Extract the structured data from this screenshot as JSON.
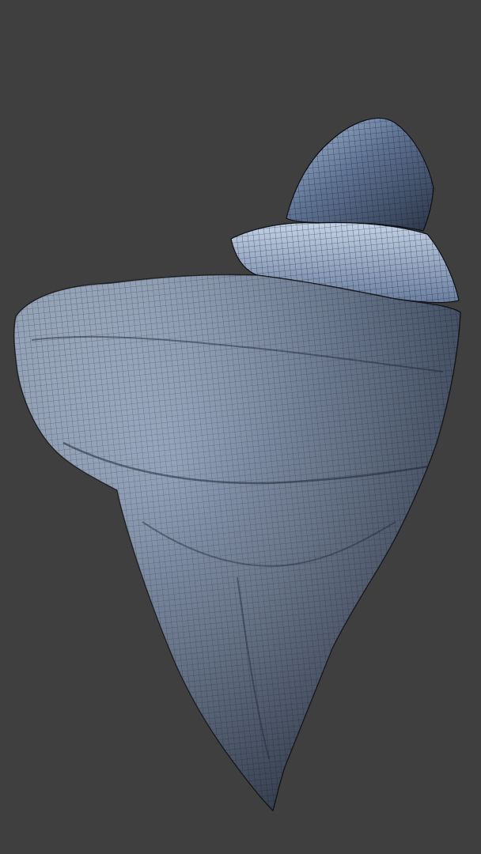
{
  "viewport": {
    "background_color": "#3f3f3f"
  },
  "model": {
    "kind": "floating-rock-island",
    "display_mode": "wireframe-on-shaded",
    "base_color": "#5f7394",
    "highlight_color": "#a9bedb",
    "shadow_color": "#1f2838",
    "wire_color": "#0e1118"
  }
}
